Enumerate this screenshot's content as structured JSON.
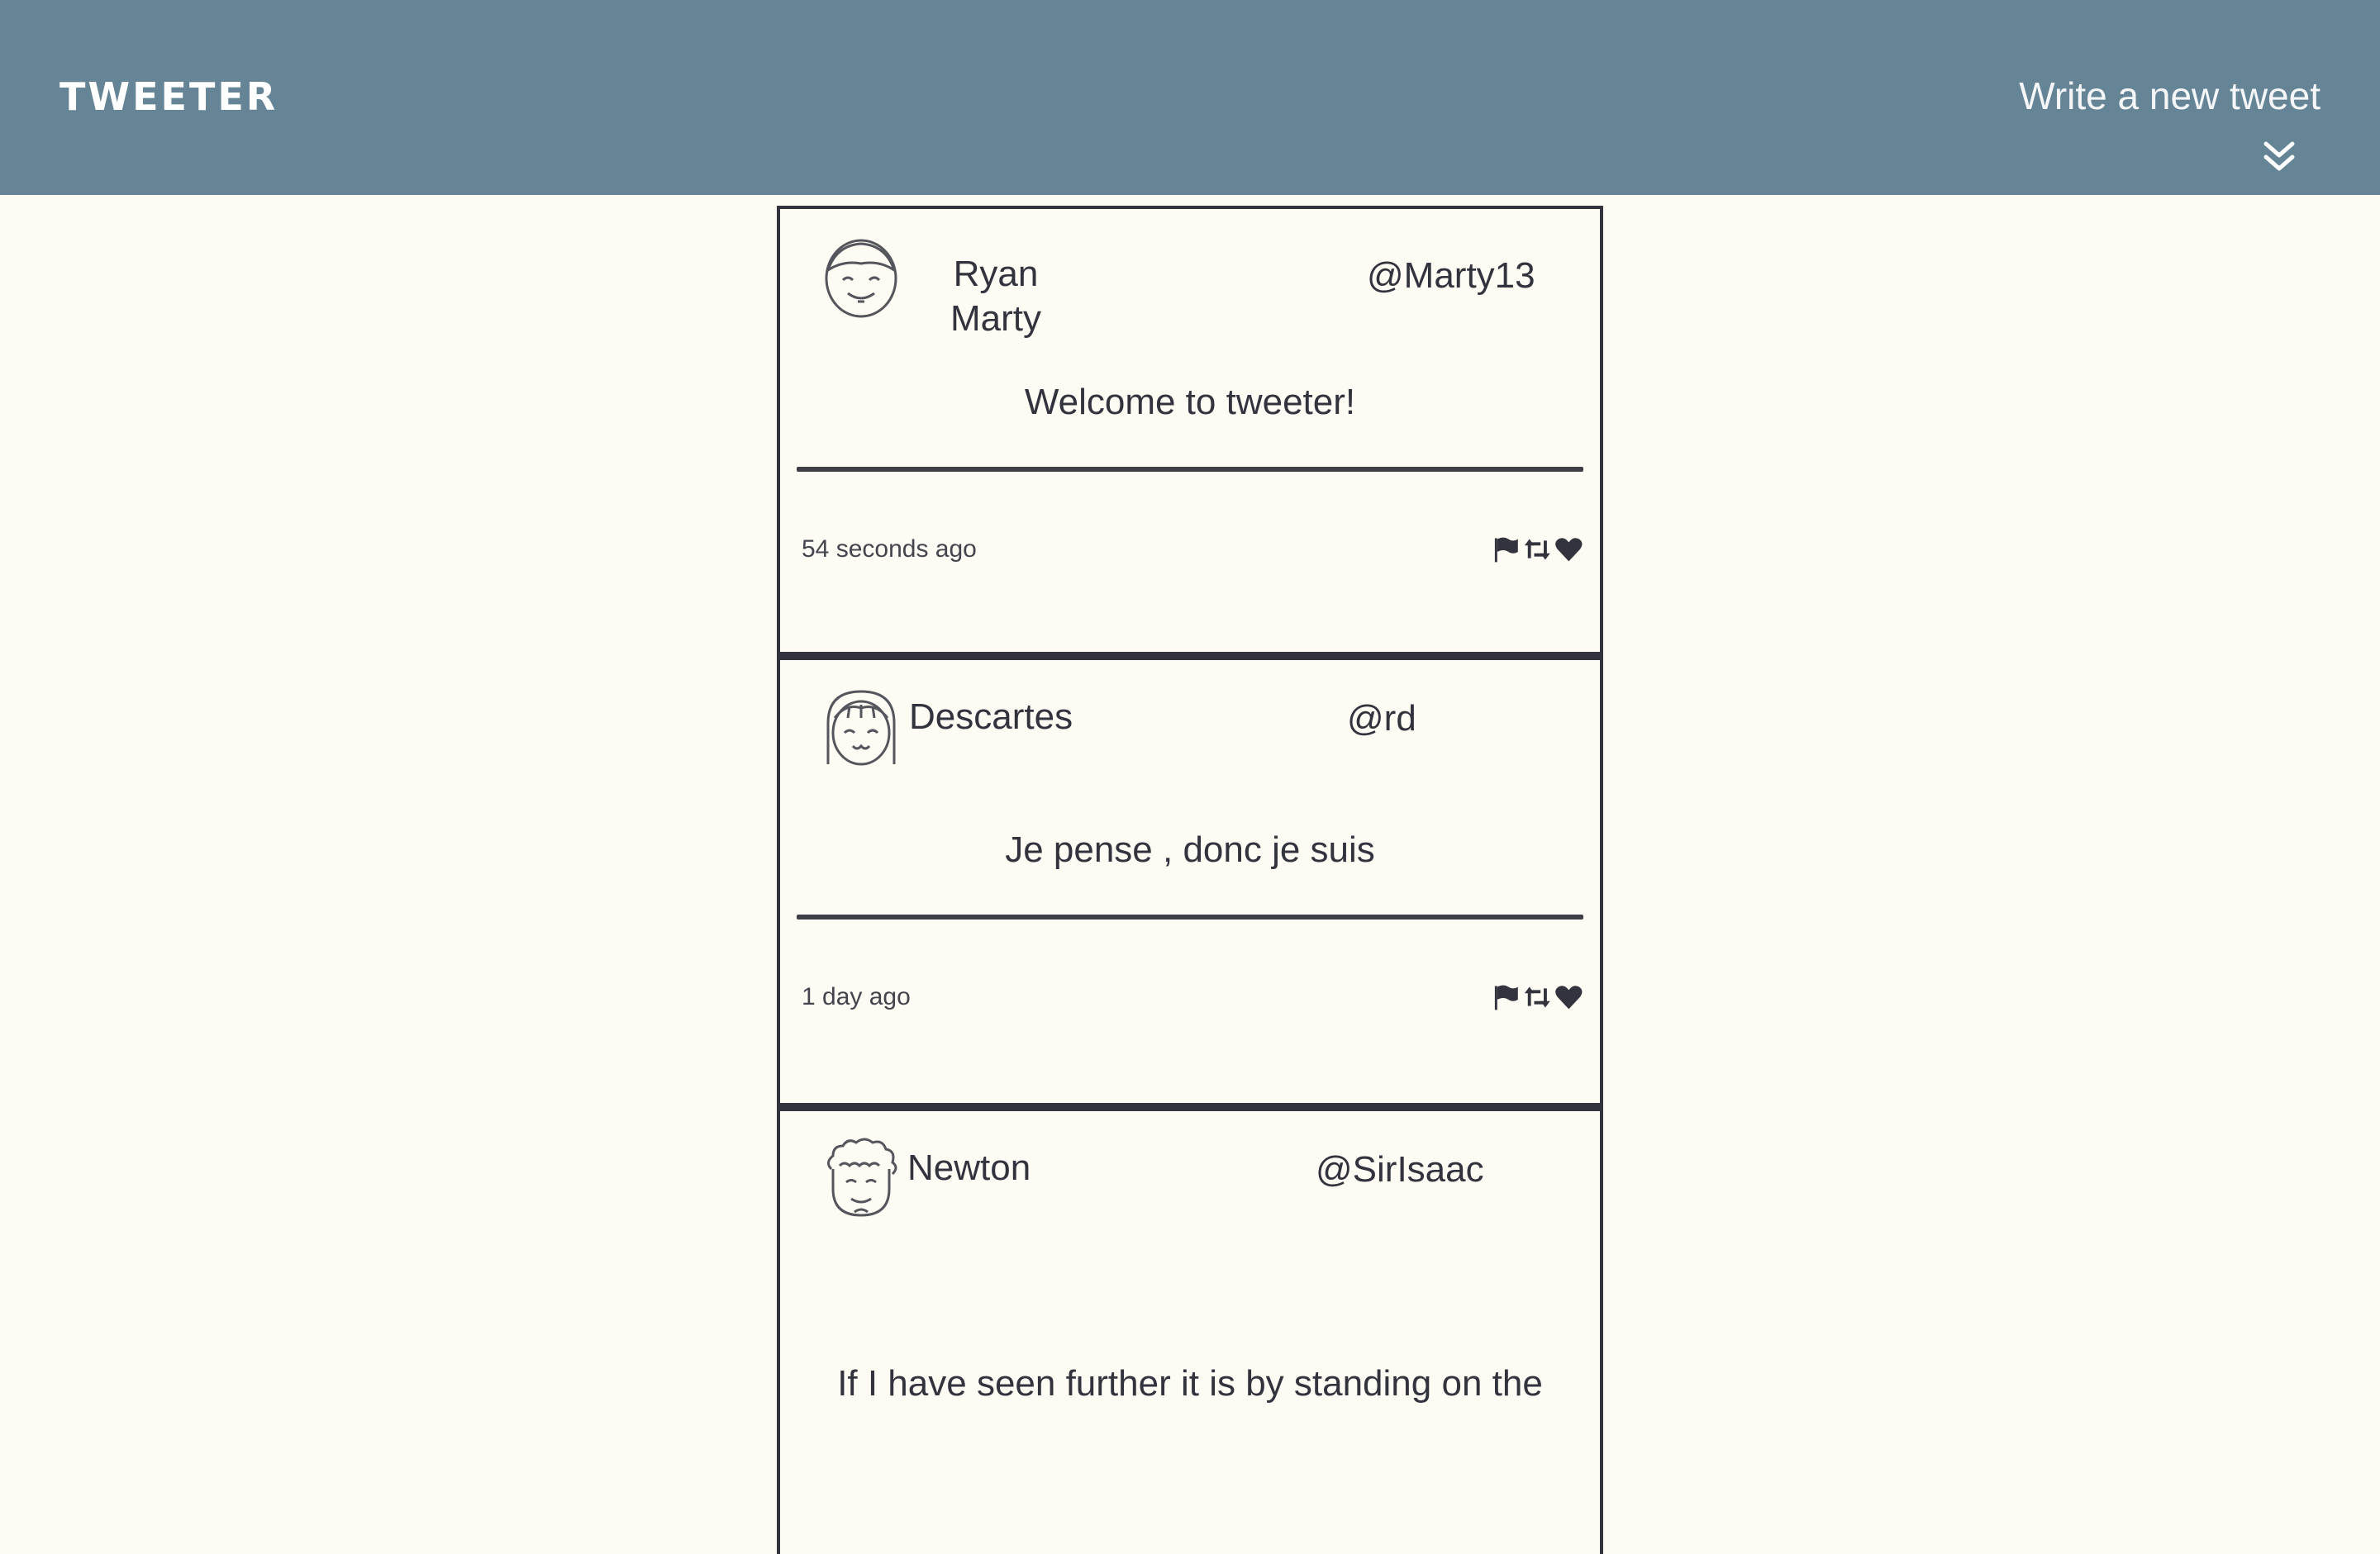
{
  "nav": {
    "logo": "TWEETER",
    "compose_label": "Write a new tweet",
    "compose_icon": "double-chevron-down-icon"
  },
  "colors": {
    "nav_background": "#658496",
    "page_background": "#fefbf5",
    "ink": "#33333d"
  },
  "tweets": [
    {
      "name": "Ryan Marty",
      "handle": "@Marty13",
      "content": "Welcome to tweeter!",
      "timestamp": "54 seconds ago",
      "avatar_icon": "smiling-face-avatar-icon",
      "actions": [
        "flag-icon",
        "retweet-icon",
        "heart-icon"
      ]
    },
    {
      "name": "Descartes",
      "handle": "@rd",
      "content": "Je pense , donc je suis",
      "timestamp": "1 day ago",
      "avatar_icon": "girl-with-bangs-avatar-icon",
      "actions": [
        "flag-icon",
        "retweet-icon",
        "heart-icon"
      ]
    },
    {
      "name": "Newton",
      "handle": "@SirIsaac",
      "content": "If I have seen further it is by standing on the",
      "timestamp": "",
      "avatar_icon": "curly-hair-avatar-icon",
      "actions": []
    }
  ]
}
